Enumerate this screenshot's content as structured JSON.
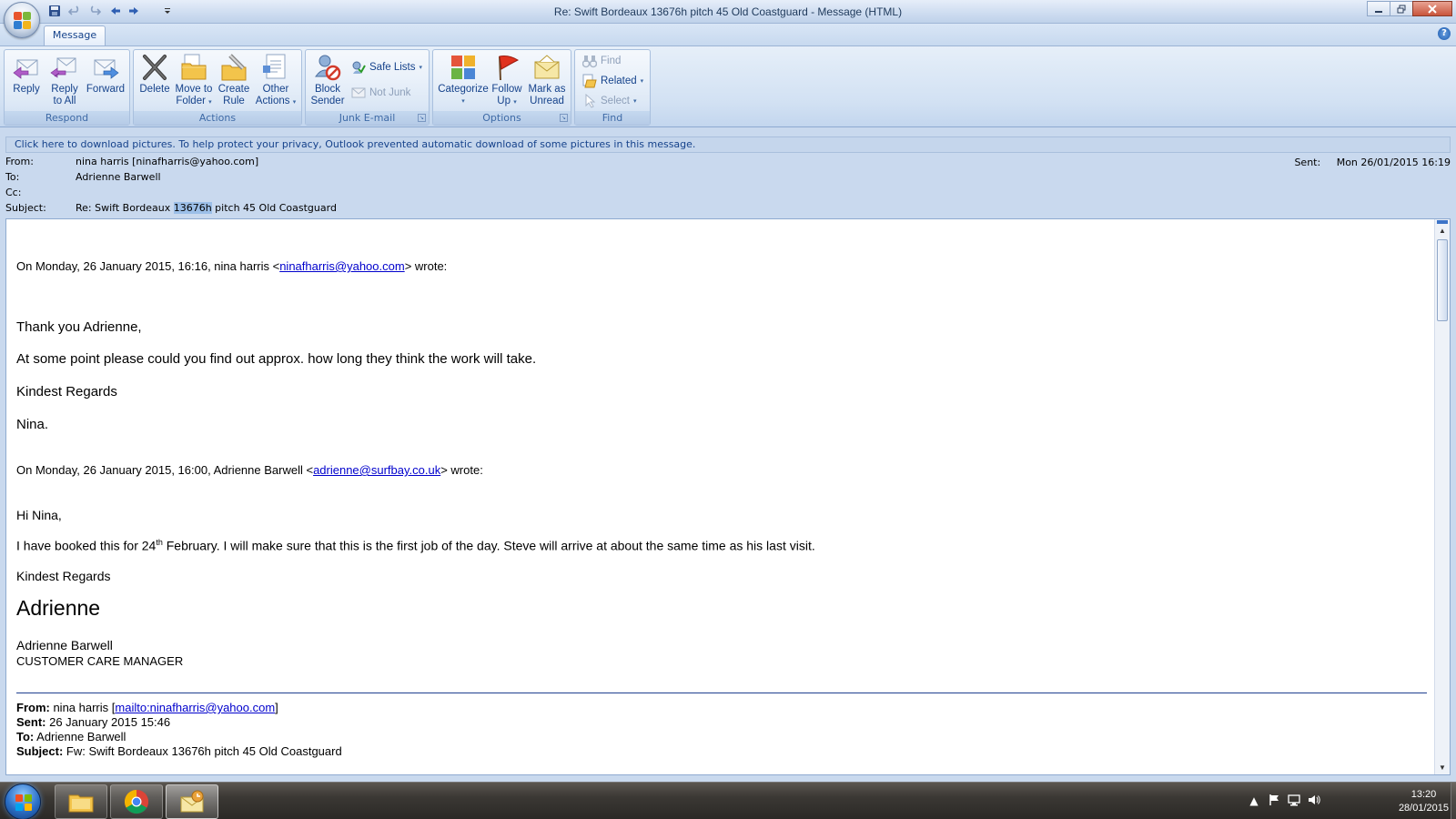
{
  "window": {
    "title": "Re: Swift Bordeaux 13676h pitch 45 Old Coastguard - Message (HTML)"
  },
  "ribbon": {
    "tab": "Message",
    "groups": {
      "respond": {
        "label": "Respond",
        "reply": "Reply",
        "reply_all_1": "Reply",
        "reply_all_2": "to All",
        "forward": "Forward"
      },
      "actions": {
        "label": "Actions",
        "delete": "Delete",
        "move_1": "Move to",
        "move_2": "Folder",
        "create_1": "Create",
        "create_2": "Rule",
        "other_1": "Other",
        "other_2": "Actions"
      },
      "junk": {
        "label": "Junk E-mail",
        "block_1": "Block",
        "block_2": "Sender",
        "safe_lists": "Safe Lists",
        "not_junk": "Not Junk"
      },
      "options": {
        "label": "Options",
        "categorize": "Categorize",
        "follow_1": "Follow",
        "follow_2": "Up",
        "mark_1": "Mark as",
        "mark_2": "Unread"
      },
      "find": {
        "label": "Find",
        "find": "Find",
        "related": "Related",
        "select": "Select"
      }
    }
  },
  "infobar": "Click here to download pictures. To help protect your privacy, Outlook prevented automatic download of some pictures in this message.",
  "header": {
    "from_label": "From:",
    "from": "nina harris [ninafharris@yahoo.com]",
    "to_label": "To:",
    "to": "Adrienne Barwell",
    "cc_label": "Cc:",
    "subject_label": "Subject:",
    "subject_pre": "Re: Swift Bordeaux ",
    "subject_hl": "13676h",
    "subject_post": " pitch 45 Old Coastguard",
    "sent_label": "Sent:",
    "sent": "Mon 26/01/2015 16:19"
  },
  "body": {
    "q1_pre": "On Monday, 26 January 2015, 16:16, nina harris <",
    "q1_email": "ninafharris@yahoo.com",
    "q1_post": "> wrote:",
    "thanks": "Thank you Adrienne,",
    "ask": "At some point please could you find out  approx. how long they think the work will take.",
    "regards1": "Kindest Regards",
    "nina": "Nina.",
    "q2_pre": "On Monday, 26 January 2015, 16:00, Adrienne Barwell <",
    "q2_email": "adrienne@surfbay.co.uk",
    "q2_post": "> wrote:",
    "hi": "Hi Nina,",
    "booked_pre": "I have booked this for 24",
    "booked_sup": "th",
    "booked_post": " February.  I will make sure that this is the first job of the day.  Steve will arrive at about the same time as his  last visit.",
    "regards2": "Kindest Regards",
    "sig_big": "Adrienne",
    "sig_name": "Adrienne Barwell",
    "sig_title": "CUSTOMER CARE MANAGER",
    "fw_from_label": "From:",
    "fw_from_pre": " nina harris [",
    "fw_from_link": "mailto:ninafharris@yahoo.com",
    "fw_from_post": "]",
    "fw_sent_label": "Sent:",
    "fw_sent": " 26 January 2015 15:46",
    "fw_to_label": "To:",
    "fw_to": " Adrienne Barwell",
    "fw_subject_label": "Subject:",
    "fw_subject": " Fw: Swift Bordeaux 13676h pitch 45 Old Coastguard"
  },
  "taskbar": {
    "time": "13:20",
    "date": "28/01/2015"
  },
  "icons": {
    "office_button": "office-logo-icon",
    "save": "save-icon",
    "start": "windows-start-icon"
  },
  "colors": {
    "ribbon_text": "#15428b",
    "link": "#0000cc",
    "highlight": "#9cbfe8"
  }
}
